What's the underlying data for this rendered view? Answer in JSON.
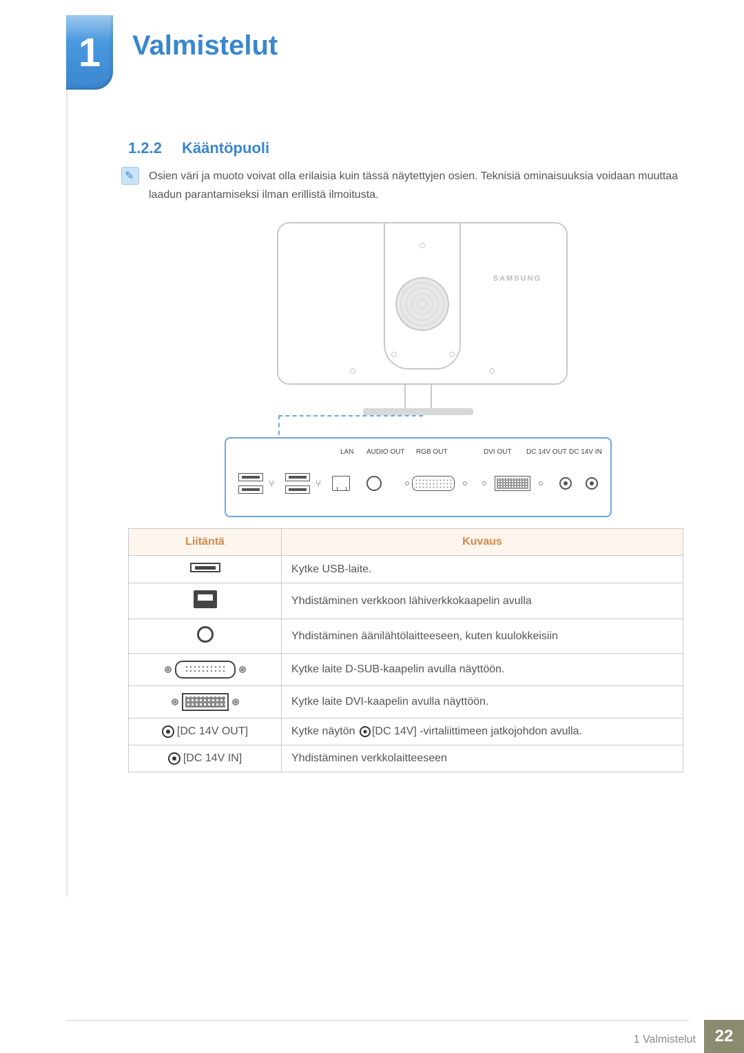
{
  "chapter": {
    "number": "1",
    "title": "Valmistelut"
  },
  "section": {
    "number": "1.2.2",
    "title": "Kääntöpuoli"
  },
  "note": "Osien väri ja muoto voivat olla erilaisia kuin tässä näytettyjen osien. Teknisiä ominaisuuksia voidaan muuttaa laadun parantamiseksi ilman erillistä ilmoitusta.",
  "diagram": {
    "brand": "SAMSUNG",
    "port_labels": {
      "lan": "LAN",
      "audio_out": "AUDIO OUT",
      "rgb_out": "RGB OUT",
      "dvi_out": "DVI OUT",
      "dc_out": "DC 14V OUT",
      "dc_in": "DC 14V IN"
    }
  },
  "table": {
    "headers": {
      "port": "Liitäntä",
      "desc": "Kuvaus"
    },
    "rows": {
      "usb": {
        "desc": "Kytke USB-laite."
      },
      "lan": {
        "desc": "Yhdistäminen verkkoon lähiverkkokaapelin avulla"
      },
      "audio": {
        "desc": "Yhdistäminen äänilähtölaitteeseen, kuten kuulokkeisiin"
      },
      "vga": {
        "desc": "Kytke laite D-SUB-kaapelin avulla näyttöön."
      },
      "dvi": {
        "desc": "Kytke laite DVI-kaapelin avulla näyttöön."
      },
      "dcout": {
        "label": "[DC 14V OUT]",
        "desc_pre": "Kytke näytön ",
        "desc_mid": "[DC 14V] ",
        "desc_post": "-virtaliittimeen jatkojohdon avulla."
      },
      "dcin": {
        "label": "[DC 14V IN]",
        "desc": "Yhdistäminen verkkolaitteeseen"
      }
    }
  },
  "footer": {
    "crumb": "1 Valmistelut",
    "pageno": "22"
  }
}
